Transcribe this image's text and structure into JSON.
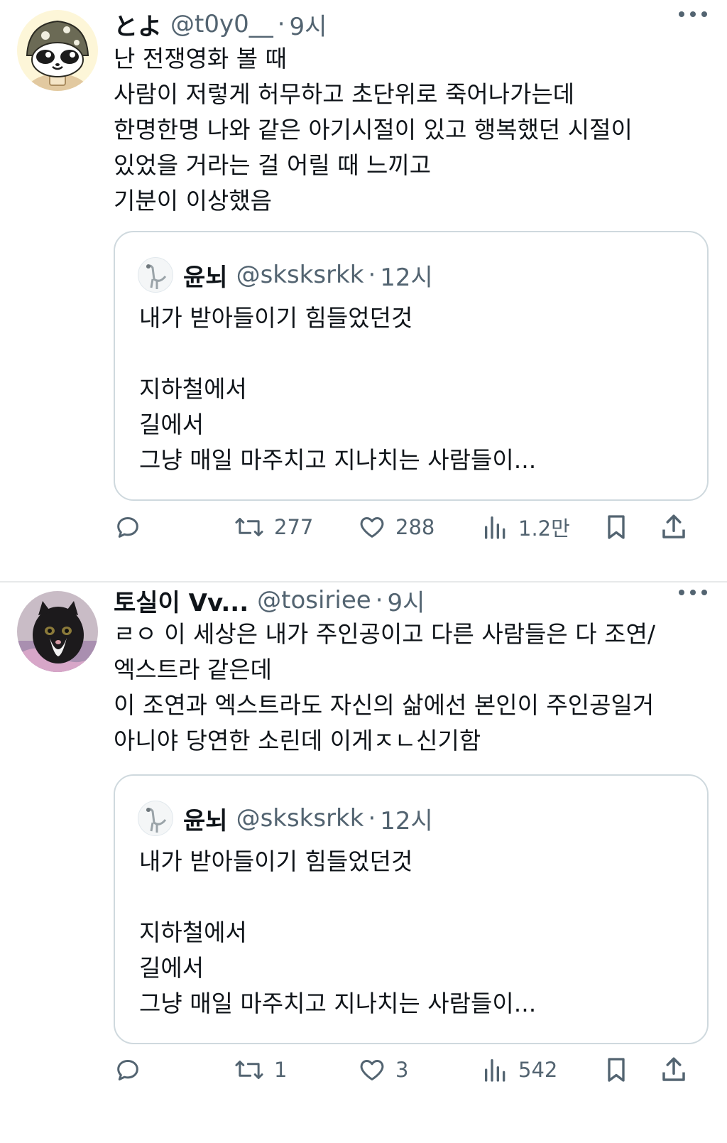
{
  "tweets": [
    {
      "display_name": "とよ",
      "handle": "@t0y0__",
      "separator": "·",
      "time": "9시",
      "text": "난 전쟁영화 볼 때\n사람이 저렇게 허무하고 초단위로 죽어나가는데\n한명한명 나와 같은 아기시절이 있고 행복했던 시절이\n있었을 거라는 걸 어릴 때 느끼고\n기분이 이상했음",
      "quote": {
        "display_name": "윤뇌",
        "handle": "@sksksrkk",
        "separator": "·",
        "time": "12시",
        "text": "내가 받아들이기 힘들었던것\n\n지하철에서\n길에서\n그냥 매일 마주치고 지나치는 사람들이..."
      },
      "actions": {
        "reply": "",
        "retweet": "277",
        "like": "288",
        "views": "1.2만"
      }
    },
    {
      "display_name": "토실이 Vv...",
      "handle": "@tosiriee",
      "separator": "·",
      "time": "9시",
      "text": "ㄹㅇ 이 세상은 내가 주인공이고 다른 사람들은 다 조연/\n엑스트라 같은데\n이 조연과 엑스트라도 자신의 삶에선 본인이 주인공일거\n아니야 당연한 소린데 이게ㅈㄴ신기함",
      "quote": {
        "display_name": "윤뇌",
        "handle": "@sksksrkk",
        "separator": "·",
        "time": "12시",
        "text": "내가 받아들이기 힘들었던것\n\n지하철에서\n길에서\n그냥 매일 마주치고 지나치는 사람들이..."
      },
      "actions": {
        "reply": "",
        "retweet": "1",
        "like": "3",
        "views": "542"
      }
    }
  ],
  "icons": {
    "reply": "reply-bubble-icon",
    "retweet": "retweet-arrows-icon",
    "like": "heart-icon",
    "views": "bar-chart-icon",
    "bookmark": "bookmark-icon",
    "share": "share-upload-icon",
    "more": "more-dots-icon"
  },
  "colors": {
    "text": "#0f1419",
    "secondary": "#536471",
    "border": "#cfd9de",
    "divider": "#e7e9ea"
  }
}
